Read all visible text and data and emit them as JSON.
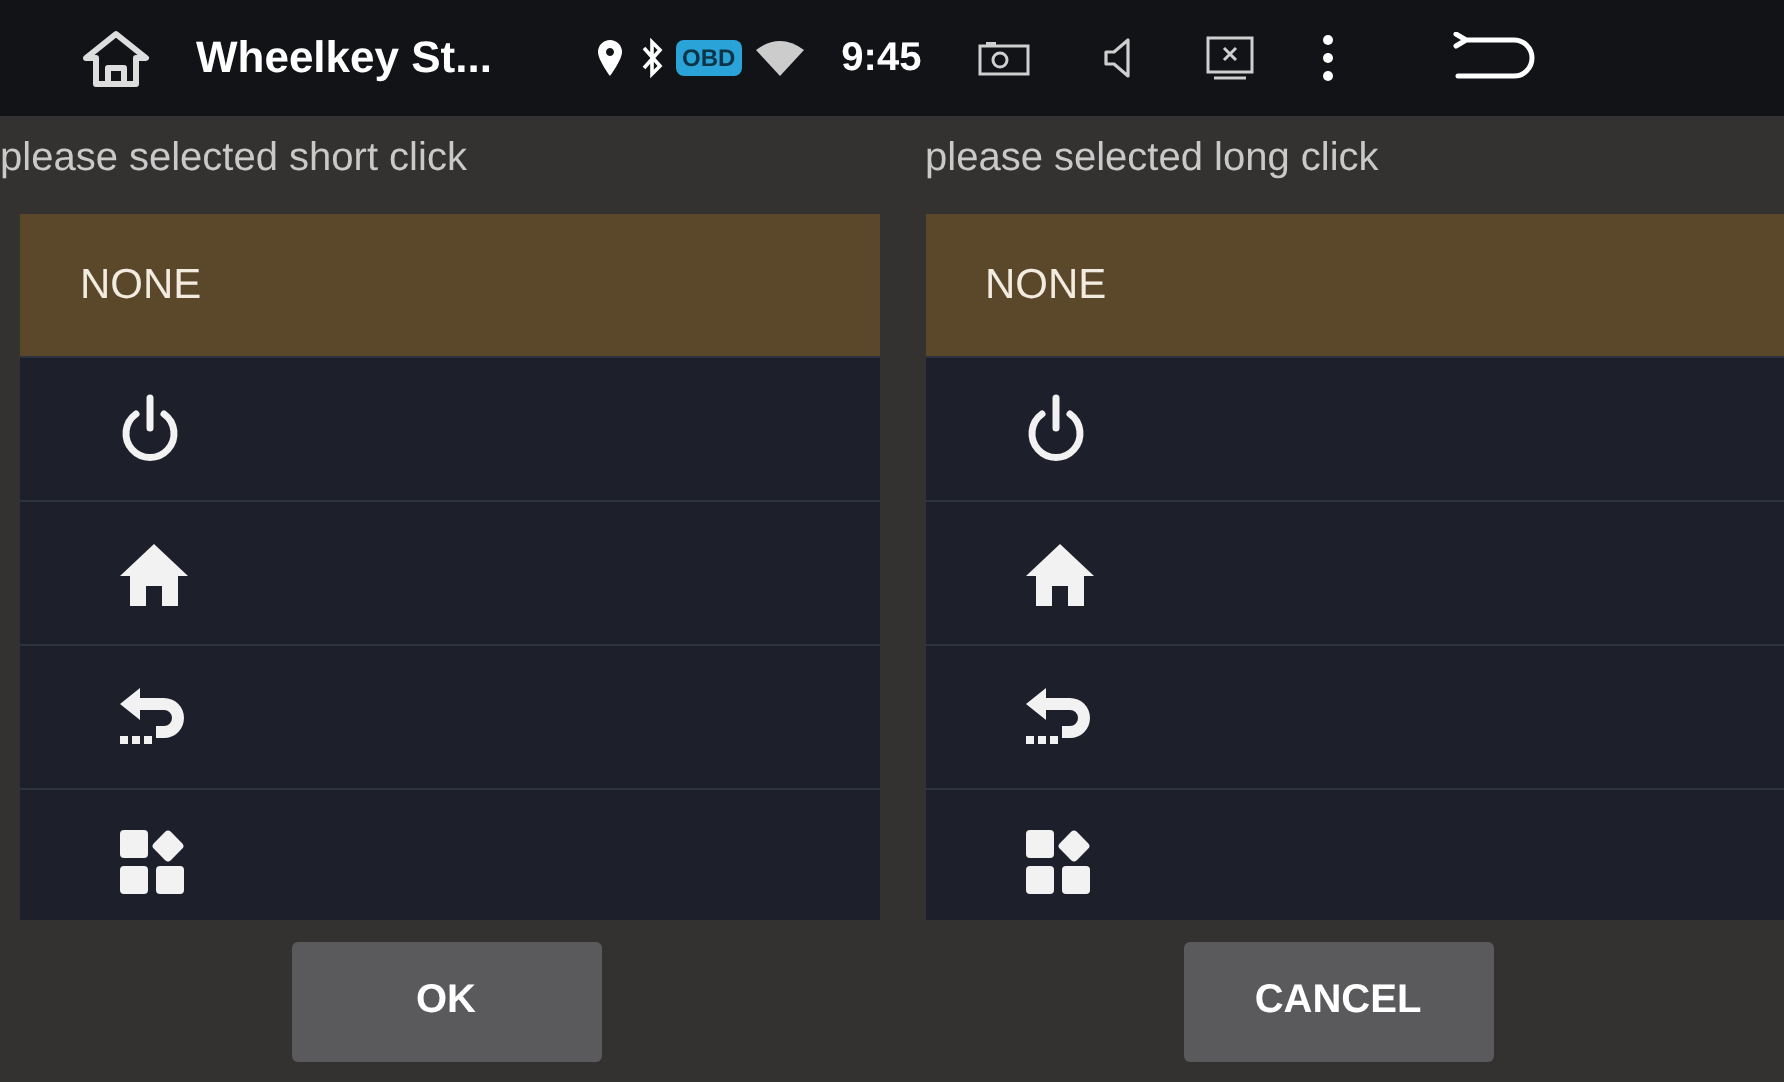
{
  "status_bar": {
    "title": "Wheelkey St...",
    "badge": "OBD",
    "time": "9:45"
  },
  "panels": [
    {
      "caption": "please selected short click",
      "items": [
        {
          "kind": "text",
          "label": "NONE",
          "selected": true
        },
        {
          "kind": "power",
          "selected": false
        },
        {
          "kind": "home",
          "selected": false
        },
        {
          "kind": "back",
          "selected": false
        },
        {
          "kind": "apps",
          "selected": false
        }
      ]
    },
    {
      "caption": "please selected long click",
      "items": [
        {
          "kind": "text",
          "label": "NONE",
          "selected": true
        },
        {
          "kind": "power",
          "selected": false
        },
        {
          "kind": "home",
          "selected": false
        },
        {
          "kind": "back",
          "selected": false
        },
        {
          "kind": "apps",
          "selected": false
        }
      ]
    }
  ],
  "buttons": [
    "OK",
    "CANCEL"
  ]
}
